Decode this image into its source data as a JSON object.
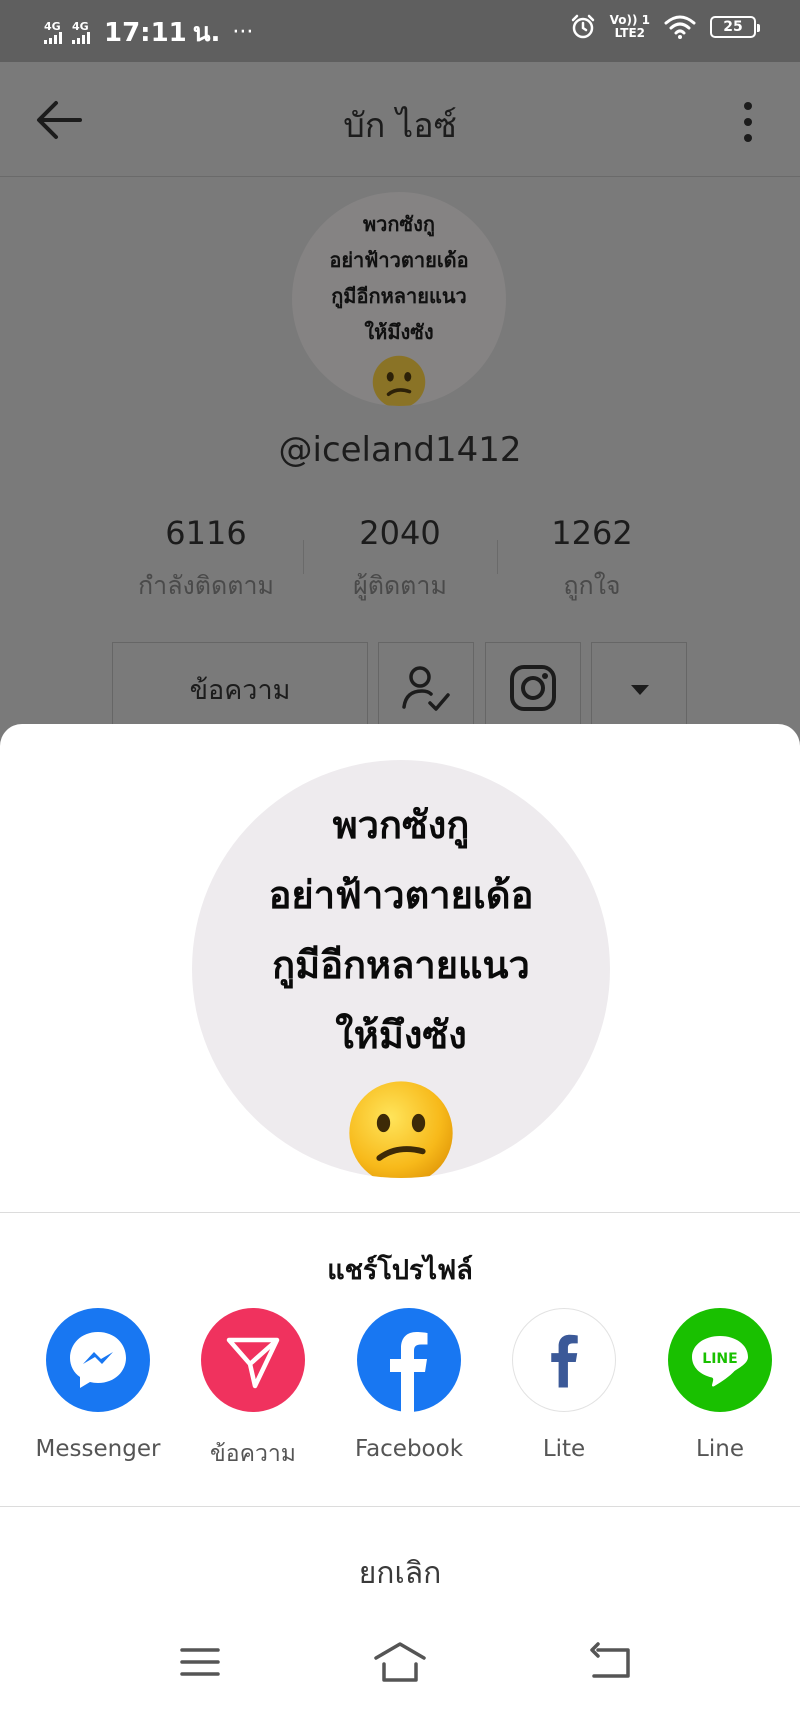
{
  "status_bar": {
    "signal1": "4G",
    "signal2": "4G",
    "time": "17:11",
    "carrier": "น.",
    "dots": "···",
    "volte_top": "Vo)) 1",
    "volte_bottom": "LTE2",
    "battery": "25"
  },
  "profile": {
    "title": "บัก ไอซ์",
    "handle": "@iceland1412",
    "avatar_caption": [
      "พวกซังกู",
      "อย่าฟ้าวตายเด้อ",
      "กูมีอีกหลายแนว",
      "ให้มึงซัง"
    ],
    "stats": [
      {
        "value": "6116",
        "label": "กำลังติดตาม"
      },
      {
        "value": "2040",
        "label": "ผู้ติดตาม"
      },
      {
        "value": "1262",
        "label": "ถูกใจ"
      }
    ],
    "message_button": "ข้อความ"
  },
  "share_sheet": {
    "avatar_caption": [
      "พวกซังกู",
      "อย่าฟ้าวตายเด้อ",
      "กูมีอีกหลายแนว",
      "ให้มึงซัง"
    ],
    "title": "แชร์โปรไฟล์",
    "apps": [
      {
        "label": "Messenger",
        "icon": "messenger-icon",
        "color": "#1877f2"
      },
      {
        "label": "ข้อความ",
        "icon": "direct-message-icon",
        "color": "#f0325e"
      },
      {
        "label": "Facebook",
        "icon": "facebook-icon",
        "color": "#1877f2"
      },
      {
        "label": "Lite",
        "icon": "facebook-lite-icon",
        "color": "#3b5998"
      },
      {
        "label": "Line",
        "icon": "line-icon",
        "color": "#19c000"
      }
    ],
    "line_badge": "LINE",
    "cancel": "ยกเลิก"
  }
}
